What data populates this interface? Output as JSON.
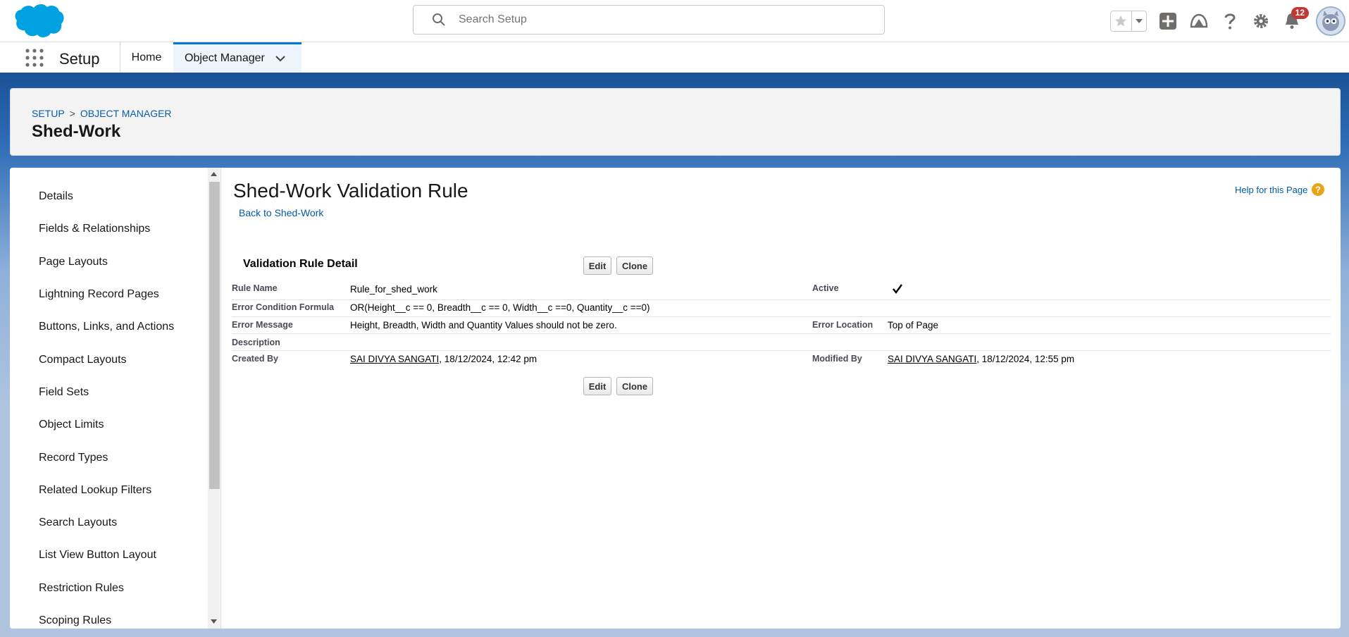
{
  "header": {
    "search_placeholder": "Search Setup",
    "notification_count": "12",
    "icons": [
      "salesforce-logo",
      "search-icon",
      "star-icon",
      "chevron-down-icon",
      "plus-icon",
      "trailhead-icon",
      "help-icon",
      "gear-icon",
      "bell-icon",
      "avatar"
    ]
  },
  "nav": {
    "app_name": "Setup",
    "tabs": [
      {
        "label": "Home"
      },
      {
        "label": "Object Manager"
      }
    ]
  },
  "page_header": {
    "breadcrumb": [
      "SETUP",
      ">",
      "OBJECT MANAGER"
    ],
    "title": "Shed-Work"
  },
  "sidebar": {
    "items": [
      {
        "label": "Details"
      },
      {
        "label": "Fields & Relationships"
      },
      {
        "label": "Page Layouts"
      },
      {
        "label": "Lightning Record Pages"
      },
      {
        "label": "Buttons, Links, and Actions"
      },
      {
        "label": "Compact Layouts"
      },
      {
        "label": "Field Sets"
      },
      {
        "label": "Object Limits"
      },
      {
        "label": "Record Types"
      },
      {
        "label": "Related Lookup Filters"
      },
      {
        "label": "Search Layouts"
      },
      {
        "label": "List View Button Layout"
      },
      {
        "label": "Restriction Rules"
      },
      {
        "label": "Scoping Rules"
      }
    ]
  },
  "main": {
    "title": "Shed-Work Validation Rule",
    "back_link": "Back to Shed-Work",
    "help_link": "Help for this Page",
    "detail_title": "Validation Rule Detail",
    "edit_label": "Edit",
    "clone_label": "Clone",
    "fields": {
      "rule_name_label": "Rule Name",
      "rule_name": "Rule_for_shed_work",
      "active_label": "Active",
      "active": true,
      "formula_label": "Error Condition Formula",
      "formula": "OR(Height__c == 0, Breadth__c == 0, Width__c ==0, Quantity__c ==0)",
      "message_label": "Error Message",
      "message": "Height, Breadth, Width and Quantity Values should not be zero.",
      "location_label": "Error Location",
      "location": "Top of Page",
      "description_label": "Description",
      "description": "",
      "created_by_label": "Created By",
      "created_by_name": "SAI DIVYA SANGATI",
      "created_by_date": ", 18/12/2024, 12:42 pm",
      "modified_by_label": "Modified By",
      "modified_by_name": "SAI DIVYA SANGATI",
      "modified_by_date": ", 18/12/2024, 12:55 pm"
    }
  },
  "colors": {
    "brand_blue": "#1b5297",
    "link_blue": "#015ba7",
    "badge_red": "#c23934",
    "salesforce_cloud": "#00a1e0"
  }
}
